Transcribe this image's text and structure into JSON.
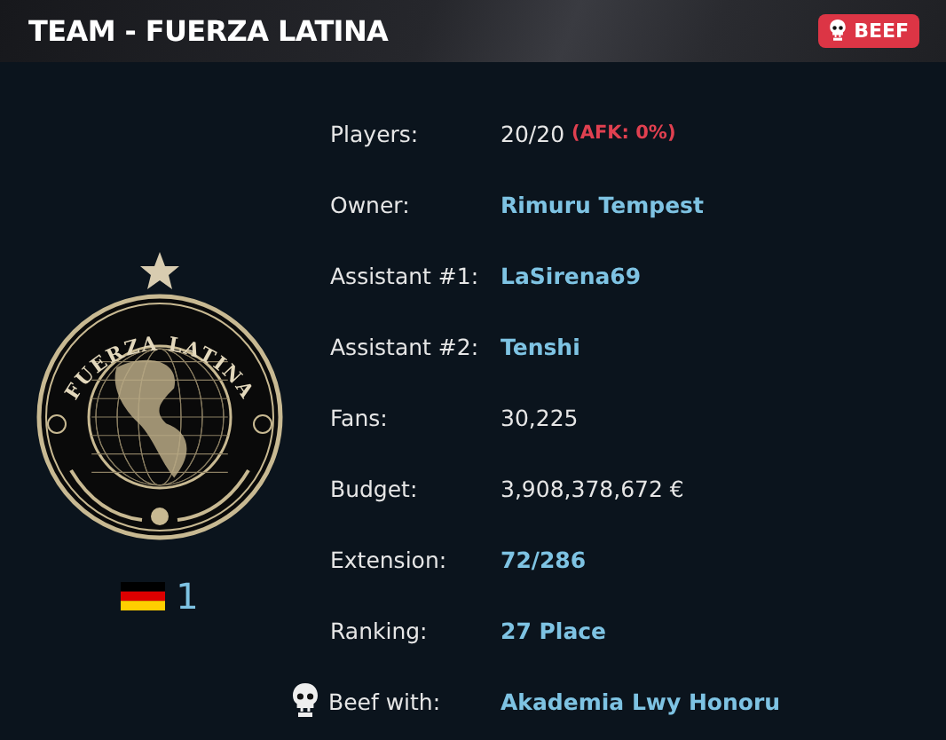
{
  "header": {
    "title": "TEAM - FUERZA LATINA",
    "badge": {
      "label": "BEEF"
    }
  },
  "crest": {
    "logo_text": "FUERZA LATINA",
    "rank": "1"
  },
  "details": [
    {
      "label": "Players:",
      "kind": "text",
      "value": "20/20",
      "note": "(AFK: 0%)"
    },
    {
      "label": "Owner:",
      "kind": "link",
      "value": "Rimuru Tempest"
    },
    {
      "label": "Assistant #1:",
      "kind": "link",
      "value": "LaSirena69"
    },
    {
      "label": "Assistant #2:",
      "kind": "link",
      "value": "Tenshi"
    },
    {
      "label": "Fans:",
      "kind": "text",
      "value": "30,225"
    },
    {
      "label": "Budget:",
      "kind": "text",
      "value": "3,908,378,672 €"
    },
    {
      "label": "Extension:",
      "kind": "link",
      "value": "72/286"
    },
    {
      "label": "Ranking:",
      "kind": "link",
      "value": "27 Place"
    },
    {
      "label": "Beef with:",
      "kind": "beef",
      "value": "Akademia Lwy Honoru"
    }
  ]
}
